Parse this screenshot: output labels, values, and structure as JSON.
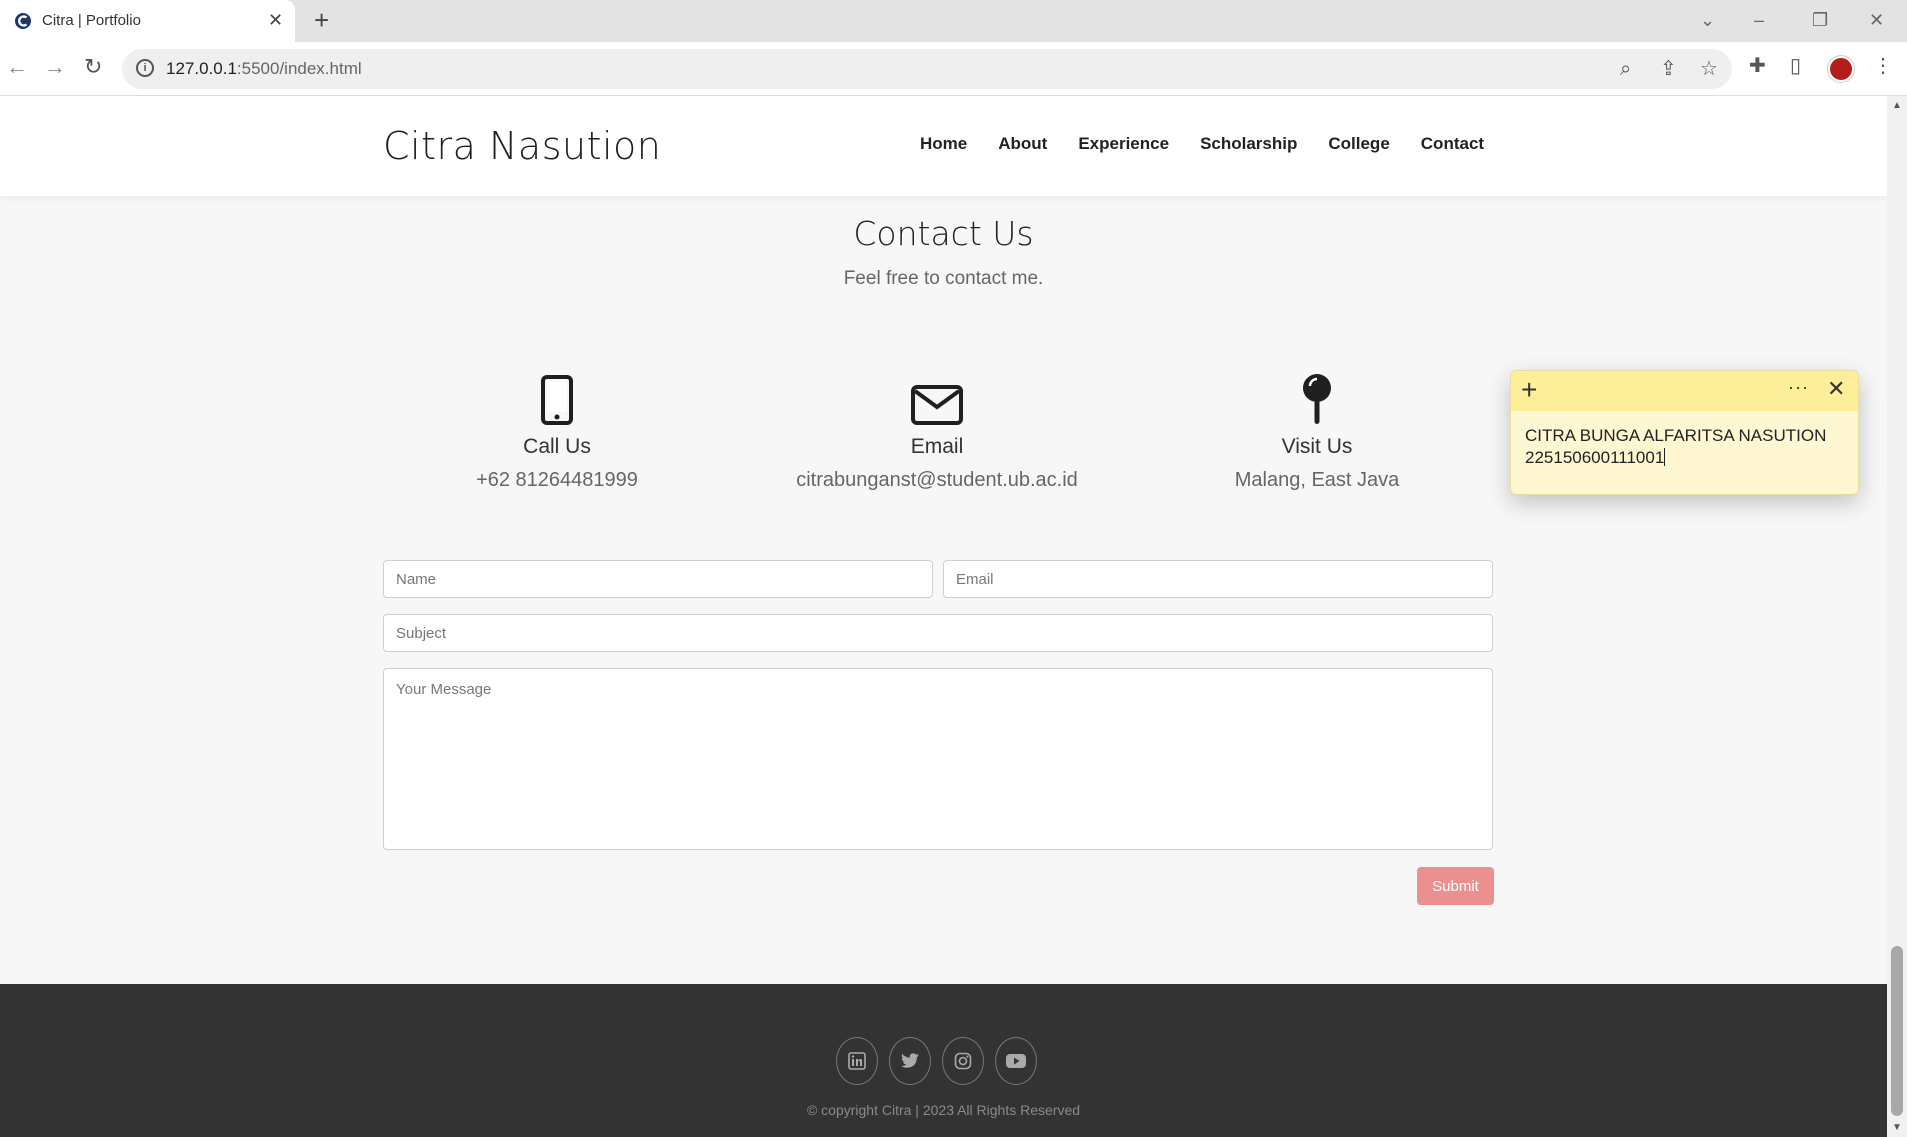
{
  "browser": {
    "tab_title": "Citra | Portfolio",
    "url_host": "127.0.0.1",
    "url_rest": ":5500/index.html"
  },
  "site": {
    "brand": "Citra Nasution",
    "nav": [
      "Home",
      "About",
      "Experience",
      "Scholarship",
      "College",
      "Contact"
    ]
  },
  "contact": {
    "title": "Contact Us",
    "subtitle": "Feel free to contact me.",
    "items": [
      {
        "icon": "phone-icon",
        "title": "Call Us",
        "value": "+62 81264481999"
      },
      {
        "icon": "envelope-icon",
        "title": "Email",
        "value": "citrabunganst@student.ub.ac.id"
      },
      {
        "icon": "map-pin-icon",
        "title": "Visit Us",
        "value": "Malang, East Java"
      }
    ]
  },
  "form": {
    "name_placeholder": "Name",
    "email_placeholder": "Email",
    "subject_placeholder": "Subject",
    "message_placeholder": "Your Message",
    "submit_label": "Submit"
  },
  "footer": {
    "socials": [
      "linkedin-icon",
      "twitter-icon",
      "instagram-icon",
      "youtube-icon"
    ],
    "copyright": "© copyright Citra | 2023 All Rights Reserved"
  },
  "sticky_note": {
    "line1": "CITRA BUNGA ALFARITSA NASUTION",
    "line2": "225150600111001"
  },
  "colors": {
    "accent": "#ec8f8f",
    "footer_bg": "#333333",
    "sticky_bg": "#fff7d1",
    "sticky_bar": "#fdee99"
  }
}
